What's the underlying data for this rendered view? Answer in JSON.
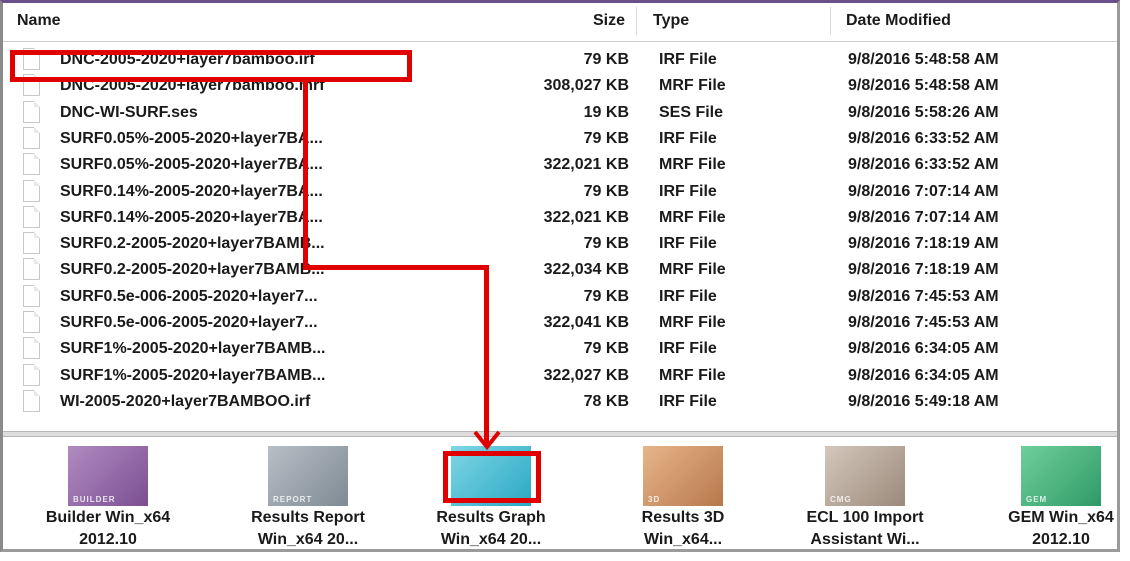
{
  "columns": {
    "name": "Name",
    "size": "Size",
    "type": "Type",
    "date": "Date Modified"
  },
  "files": [
    {
      "name": "DNC-2005-2020+layer7bamboo.irf",
      "size": "79 KB",
      "type": "IRF File",
      "date": "9/8/2016 5:48:58 AM"
    },
    {
      "name": "DNC-2005-2020+layer7bamboo.mrf",
      "size": "308,027 KB",
      "type": "MRF File",
      "date": "9/8/2016 5:48:58 AM"
    },
    {
      "name": "DNC-WI-SURF.ses",
      "size": "19 KB",
      "type": "SES File",
      "date": "9/8/2016 5:58:26 AM"
    },
    {
      "name": "SURF0.05%-2005-2020+layer7BA...",
      "size": "79 KB",
      "type": "IRF File",
      "date": "9/8/2016 6:33:52 AM"
    },
    {
      "name": "SURF0.05%-2005-2020+layer7BA...",
      "size": "322,021 KB",
      "type": "MRF File",
      "date": "9/8/2016 6:33:52 AM"
    },
    {
      "name": "SURF0.14%-2005-2020+layer7BA...",
      "size": "79 KB",
      "type": "IRF File",
      "date": "9/8/2016 7:07:14 AM"
    },
    {
      "name": "SURF0.14%-2005-2020+layer7BA...",
      "size": "322,021 KB",
      "type": "MRF File",
      "date": "9/8/2016 7:07:14 AM"
    },
    {
      "name": "SURF0.2-2005-2020+layer7BAMB...",
      "size": "79 KB",
      "type": "IRF File",
      "date": "9/8/2016 7:18:19 AM"
    },
    {
      "name": "SURF0.2-2005-2020+layer7BAMB...",
      "size": "322,034 KB",
      "type": "MRF File",
      "date": "9/8/2016 7:18:19 AM"
    },
    {
      "name": "SURF0.5e-006-2005-2020+layer7...",
      "size": "79 KB",
      "type": "IRF File",
      "date": "9/8/2016 7:45:53 AM"
    },
    {
      "name": "SURF0.5e-006-2005-2020+layer7...",
      "size": "322,041 KB",
      "type": "MRF File",
      "date": "9/8/2016 7:45:53 AM"
    },
    {
      "name": "SURF1%-2005-2020+layer7BAMB...",
      "size": "79 KB",
      "type": "IRF File",
      "date": "9/8/2016 6:34:05 AM"
    },
    {
      "name": "SURF1%-2005-2020+layer7BAMB...",
      "size": "322,027 KB",
      "type": "MRF File",
      "date": "9/8/2016 6:34:05 AM"
    },
    {
      "name": "WI-2005-2020+layer7BAMBOO.irf",
      "size": "78 KB",
      "type": "IRF File",
      "date": "9/8/2016 5:49:18 AM"
    }
  ],
  "apps": [
    {
      "line1": "Builder Win_x64",
      "line2": "2012.10",
      "tag": "BUILDER",
      "icon": "builder-icon"
    },
    {
      "line1": "Results Report",
      "line2": "Win_x64 20...",
      "tag": "REPORT",
      "icon": "results-report-icon"
    },
    {
      "line1": "Results Graph",
      "line2": "Win_x64 20...",
      "tag": "",
      "icon": "results-graph-icon"
    },
    {
      "line1": "Results 3D",
      "line2": "Win_x64...",
      "tag": "3D",
      "icon": "results-3d-icon"
    },
    {
      "line1": "ECL 100 Import",
      "line2": "Assistant Wi...",
      "tag": "CMG",
      "icon": "ecl-import-icon"
    },
    {
      "line1": "GEM Win_x64",
      "line2": "2012.10",
      "tag": "GEM",
      "icon": "gem-icon"
    }
  ],
  "annotation": {
    "color": "#e00000"
  }
}
